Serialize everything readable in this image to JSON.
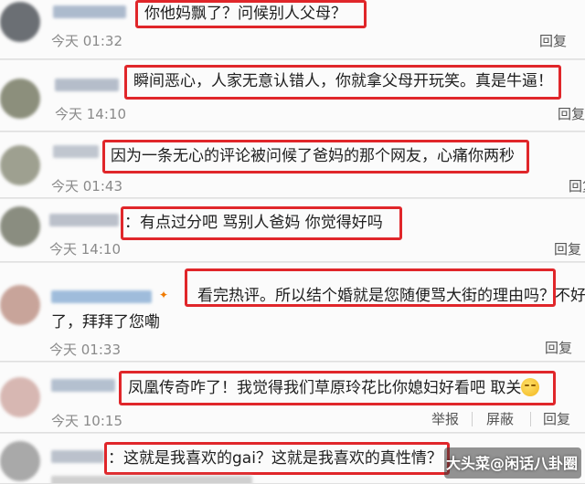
{
  "comments": [
    {
      "text": "你他妈飘了？问候别人父母？",
      "time": "今天 01:32",
      "actions": [
        "回复"
      ],
      "avatar_color": "#6b6f74",
      "name_color": "#9fb0c6"
    },
    {
      "text": "瞬间恶心，人家无意认错人，你就拿父母开玩笑。真是牛逼！",
      "time": "今天 14:10",
      "actions": [
        "回复"
      ],
      "avatar_color": "#8c8f7c",
      "name_color": "#a9b3c2"
    },
    {
      "text": "因为一条无心的评论被问候了爸妈的那个网友，心痛你两秒",
      "time": "今天 01:43",
      "actions": [
        "回复"
      ],
      "avatar_color": "#9ea090",
      "name_color": "#b6bdc8"
    },
    {
      "text": "：有点过分吧 骂别人爸妈 你觉得好吗",
      "time": "今天 14:10",
      "actions": [
        "回复"
      ],
      "avatar_color": "#8a8d80",
      "name_color": "#b0b6c2"
    },
    {
      "text": "看完热评。所以结个婚就是您随便骂大街的理由吗？不好",
      "text2": "了，拜拜了您嘞",
      "time": "今天 01:33",
      "actions": [
        "回复"
      ],
      "avatar_color": "#c8a49a",
      "name_color": "#8fb2d6"
    },
    {
      "text": "凤凰传奇咋了！我觉得我们草原玲花比你媳妇好看吧 取关",
      "time": "今天 10:15",
      "actions": [
        "举报",
        "屏蔽",
        "回复"
      ],
      "avatar_color": "#d7b7b2",
      "name_color": "#a8b6c8"
    },
    {
      "text": "：这就是我喜欢的gai？这就是我喜欢的真性情？",
      "avatar_color": "#a9a9a9",
      "name_color": "#b0b8c4"
    }
  ],
  "watermark": "大头菜@闲话八卦圈"
}
